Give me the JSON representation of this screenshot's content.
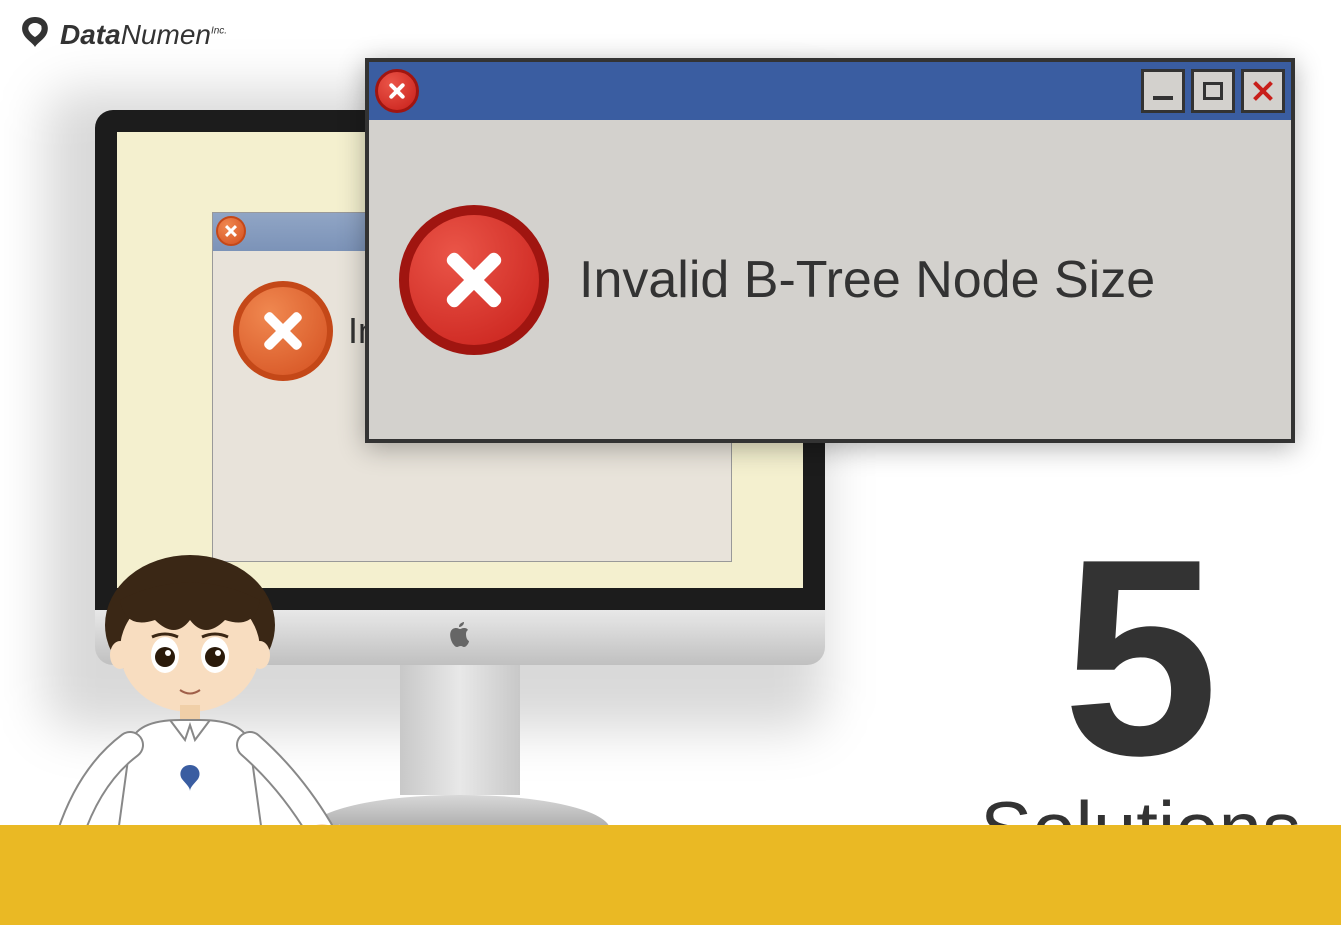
{
  "logo": {
    "brand_bold": "Data",
    "brand_thin": "Numen",
    "inc": "Inc."
  },
  "background_window": {
    "text_fragment": "In"
  },
  "main_window": {
    "error_text": "Invalid B-Tree Node Size"
  },
  "headline": {
    "number": "5",
    "label": "Solutions"
  }
}
